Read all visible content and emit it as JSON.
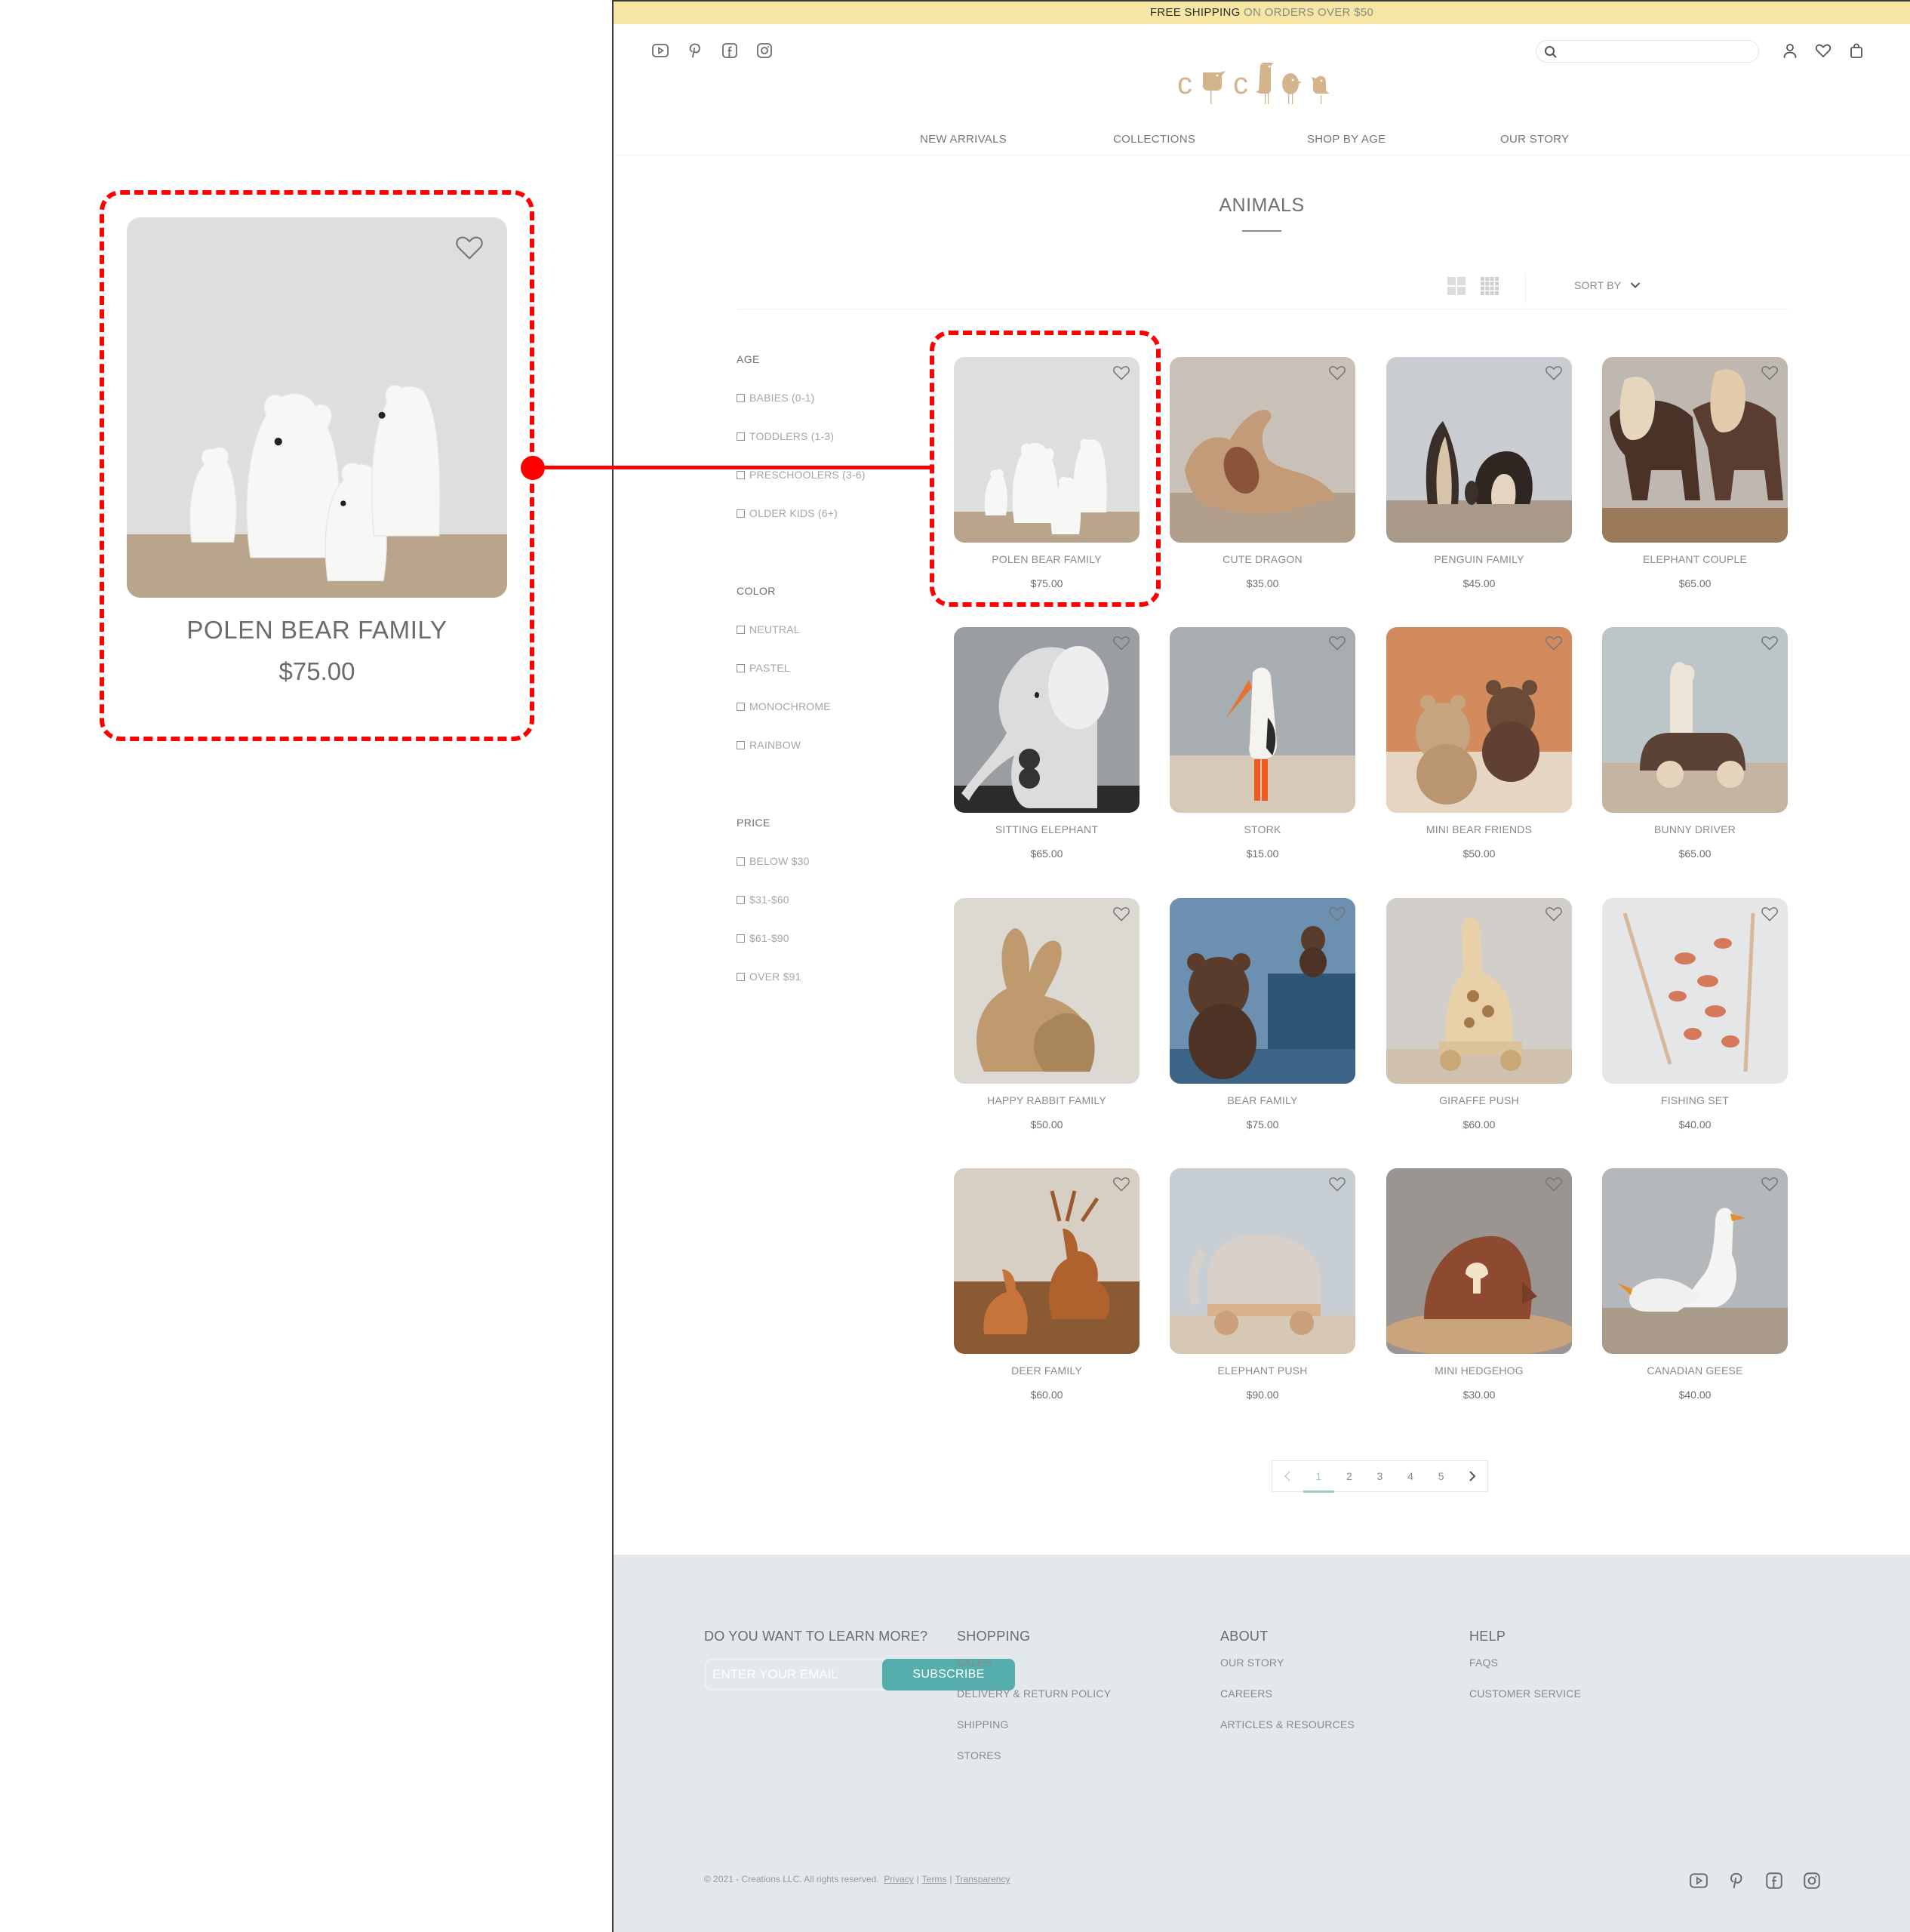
{
  "announcement": {
    "strong": "FREE SHIPPING",
    "light": " ON ORDERS OVER $50"
  },
  "header": {
    "social_icons": [
      "youtube-icon",
      "pinterest-icon",
      "facebook-icon",
      "instagram-icon"
    ],
    "search": {
      "placeholder": "",
      "value": ""
    },
    "actions": [
      "account-icon",
      "wishlist-icon",
      "bag-icon"
    ],
    "logo_text": "cucloo",
    "brand_color": "#d4b48c"
  },
  "nav": {
    "items": [
      {
        "label": "NEW ARRIVALS"
      },
      {
        "label": "COLLECTIONS"
      },
      {
        "label": "SHOP BY AGE"
      },
      {
        "label": "OUR STORY"
      }
    ]
  },
  "page": {
    "title": "ANIMALS",
    "sort_label": "SORT BY",
    "views": [
      "grid-2-icon",
      "grid-4-icon"
    ]
  },
  "filters": [
    {
      "title": "AGE",
      "options": [
        "BABIES (0-1)",
        "TODDLERS (1-3)",
        "PRESCHOOLERS (3-6)",
        "OLDER KIDS (6+)"
      ]
    },
    {
      "title": "COLOR",
      "options": [
        "NEUTRAL",
        "PASTEL",
        "MONOCHROME",
        "RAINBOW"
      ]
    },
    {
      "title": "PRICE",
      "options": [
        "BELOW $30",
        "$31-$60",
        "$61-$90",
        "OVER $91"
      ]
    }
  ],
  "products": [
    {
      "name": "POLEN BEAR FAMILY",
      "price": "$75.00"
    },
    {
      "name": "CUTE DRAGON",
      "price": "$35.00"
    },
    {
      "name": "PENGUIN FAMILY",
      "price": "$45.00"
    },
    {
      "name": "ELEPHANT COUPLE",
      "price": "$65.00"
    },
    {
      "name": "SITTING ELEPHANT",
      "price": "$65.00"
    },
    {
      "name": "STORK",
      "price": "$15.00"
    },
    {
      "name": "MINI BEAR FRIENDS",
      "price": "$50.00"
    },
    {
      "name": "BUNNY DRIVER",
      "price": "$65.00"
    },
    {
      "name": "HAPPY RABBIT FAMILY",
      "price": "$50.00"
    },
    {
      "name": "BEAR FAMILY",
      "price": "$75.00"
    },
    {
      "name": "GIRAFFE PUSH",
      "price": "$60.00"
    },
    {
      "name": "FISHING SET",
      "price": "$40.00"
    },
    {
      "name": "DEER FAMILY",
      "price": "$60.00"
    },
    {
      "name": "ELEPHANT PUSH",
      "price": "$90.00"
    },
    {
      "name": "MINI HEDGEHOG",
      "price": "$30.00"
    },
    {
      "name": "CANADIAN GEESE",
      "price": "$40.00"
    }
  ],
  "pagination": {
    "prev": "‹",
    "pages": [
      "1",
      "2",
      "3",
      "4",
      "5"
    ],
    "current": "1",
    "next": "›"
  },
  "footer": {
    "newsletter_title": "DO YOU WANT TO LEARN MORE?",
    "email_placeholder": "ENTER YOUR EMAIL",
    "subscribe_label": "SUBSCRIBE",
    "accent_color": "#55adac",
    "columns": [
      {
        "title": "SHOPPING",
        "links": [
          "SALES",
          "DELIVERY & RETURN POLICY",
          "SHIPPING",
          "STORES"
        ]
      },
      {
        "title": "ABOUT",
        "links": [
          "OUR STORY",
          "CAREERS",
          "ARTICLES & RESOURCES"
        ]
      },
      {
        "title": "HELP",
        "links": [
          "FAQS",
          "CUSTOMER SERVICE"
        ]
      }
    ],
    "copyright": "© 2021 - Creations LLC. All rights reserved.",
    "legal_links": [
      "Privacy",
      "Terms",
      "Transparency"
    ],
    "social_icons": [
      "youtube-icon",
      "pinterest-icon",
      "facebook-icon",
      "instagram-icon"
    ]
  },
  "callout": {
    "name": "POLEN BEAR FAMILY",
    "price": "$75.00",
    "highlight_color": "#ff0000"
  }
}
